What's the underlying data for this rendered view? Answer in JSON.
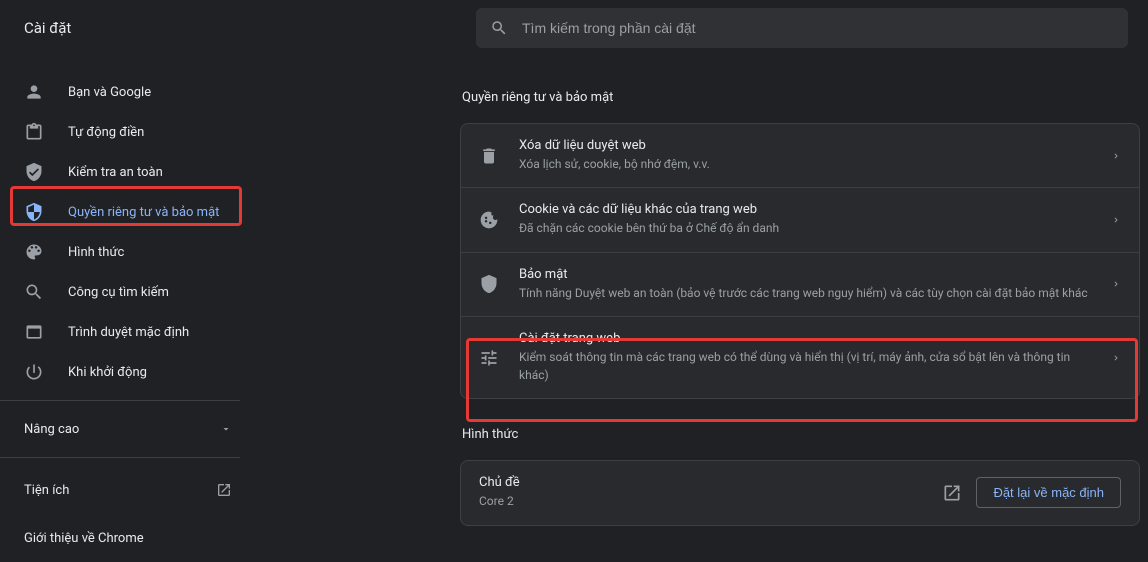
{
  "header": {
    "title": "Cài đặt"
  },
  "search": {
    "placeholder": "Tìm kiếm trong phần cài đặt"
  },
  "sidebar": {
    "items": [
      {
        "label": "Bạn và Google"
      },
      {
        "label": "Tự động điền"
      },
      {
        "label": "Kiểm tra an toàn"
      },
      {
        "label": "Quyền riêng tư và bảo mật"
      },
      {
        "label": "Hình thức"
      },
      {
        "label": "Công cụ tìm kiếm"
      },
      {
        "label": "Trình duyệt mặc định"
      },
      {
        "label": "Khi khởi động"
      }
    ],
    "advanced": "Nâng cao",
    "extensions": "Tiện ích",
    "about": "Giới thiệu về Chrome"
  },
  "privacy": {
    "title": "Quyền riêng tư và bảo mật",
    "rows": [
      {
        "title": "Xóa dữ liệu duyệt web",
        "sub": "Xóa lịch sử, cookie, bộ nhớ đệm, v.v."
      },
      {
        "title": "Cookie và các dữ liệu khác của trang web",
        "sub": "Đã chặn các cookie bên thứ ba ở Chế độ ẩn danh"
      },
      {
        "title": "Bảo mật",
        "sub": "Tính năng Duyệt web an toàn (bảo vệ trước các trang web nguy hiểm) và các tùy chọn cài đặt bảo mật khác"
      },
      {
        "title": "Cài đặt trang web",
        "sub": "Kiểm soát thông tin mà các trang web có thể dùng và hiển thị (vị trí, máy ảnh, cửa sổ bật lên và thông tin khác)"
      }
    ]
  },
  "appearance": {
    "title": "Hình thức",
    "theme_title": "Chủ đề",
    "theme_name": "Core 2",
    "reset": "Đặt lại về mặc định"
  }
}
